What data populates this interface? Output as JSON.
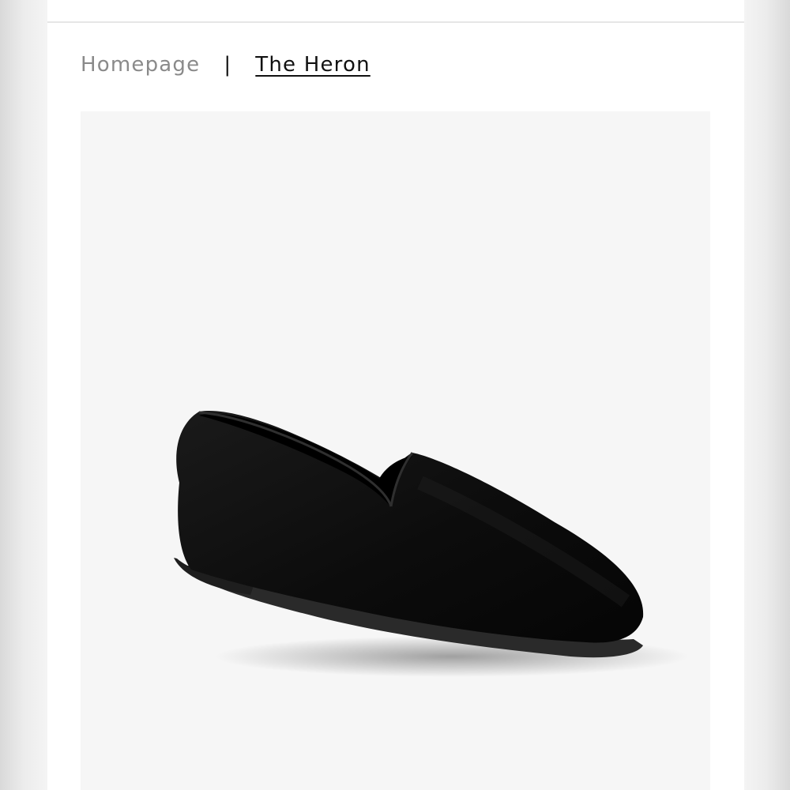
{
  "breadcrumb": {
    "home_label": "Homepage",
    "separator": "|",
    "current_label": "The Heron"
  },
  "product": {
    "image_icon": "black-suede-loafer-image"
  },
  "colors": {
    "home_link": "#8a8a8a",
    "current_link": "#111111",
    "image_background": "#f6f6f6"
  }
}
